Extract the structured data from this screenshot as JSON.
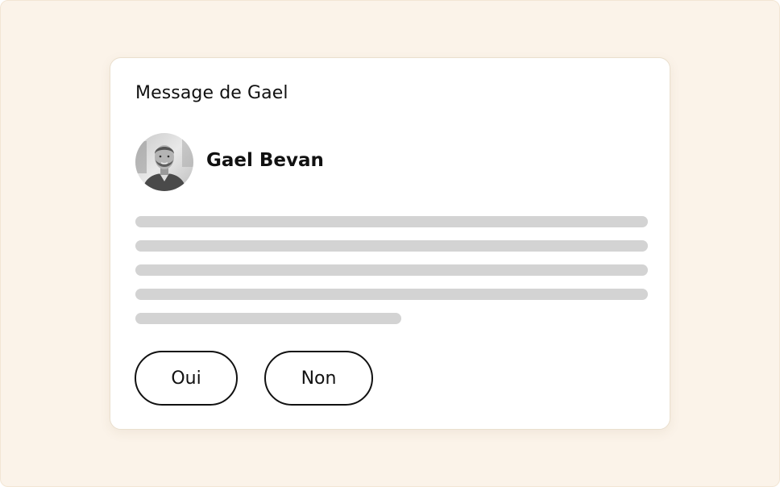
{
  "message_card": {
    "title": "Message de Gael",
    "sender": {
      "name": "Gael Bevan"
    },
    "body_placeholder_lines": 5,
    "actions": {
      "yes_label": "Oui",
      "no_label": "Non"
    }
  },
  "colors": {
    "background": "#fbf3e9",
    "card": "#ffffff",
    "placeholder_line": "#d3d3d3",
    "text": "#111111"
  }
}
